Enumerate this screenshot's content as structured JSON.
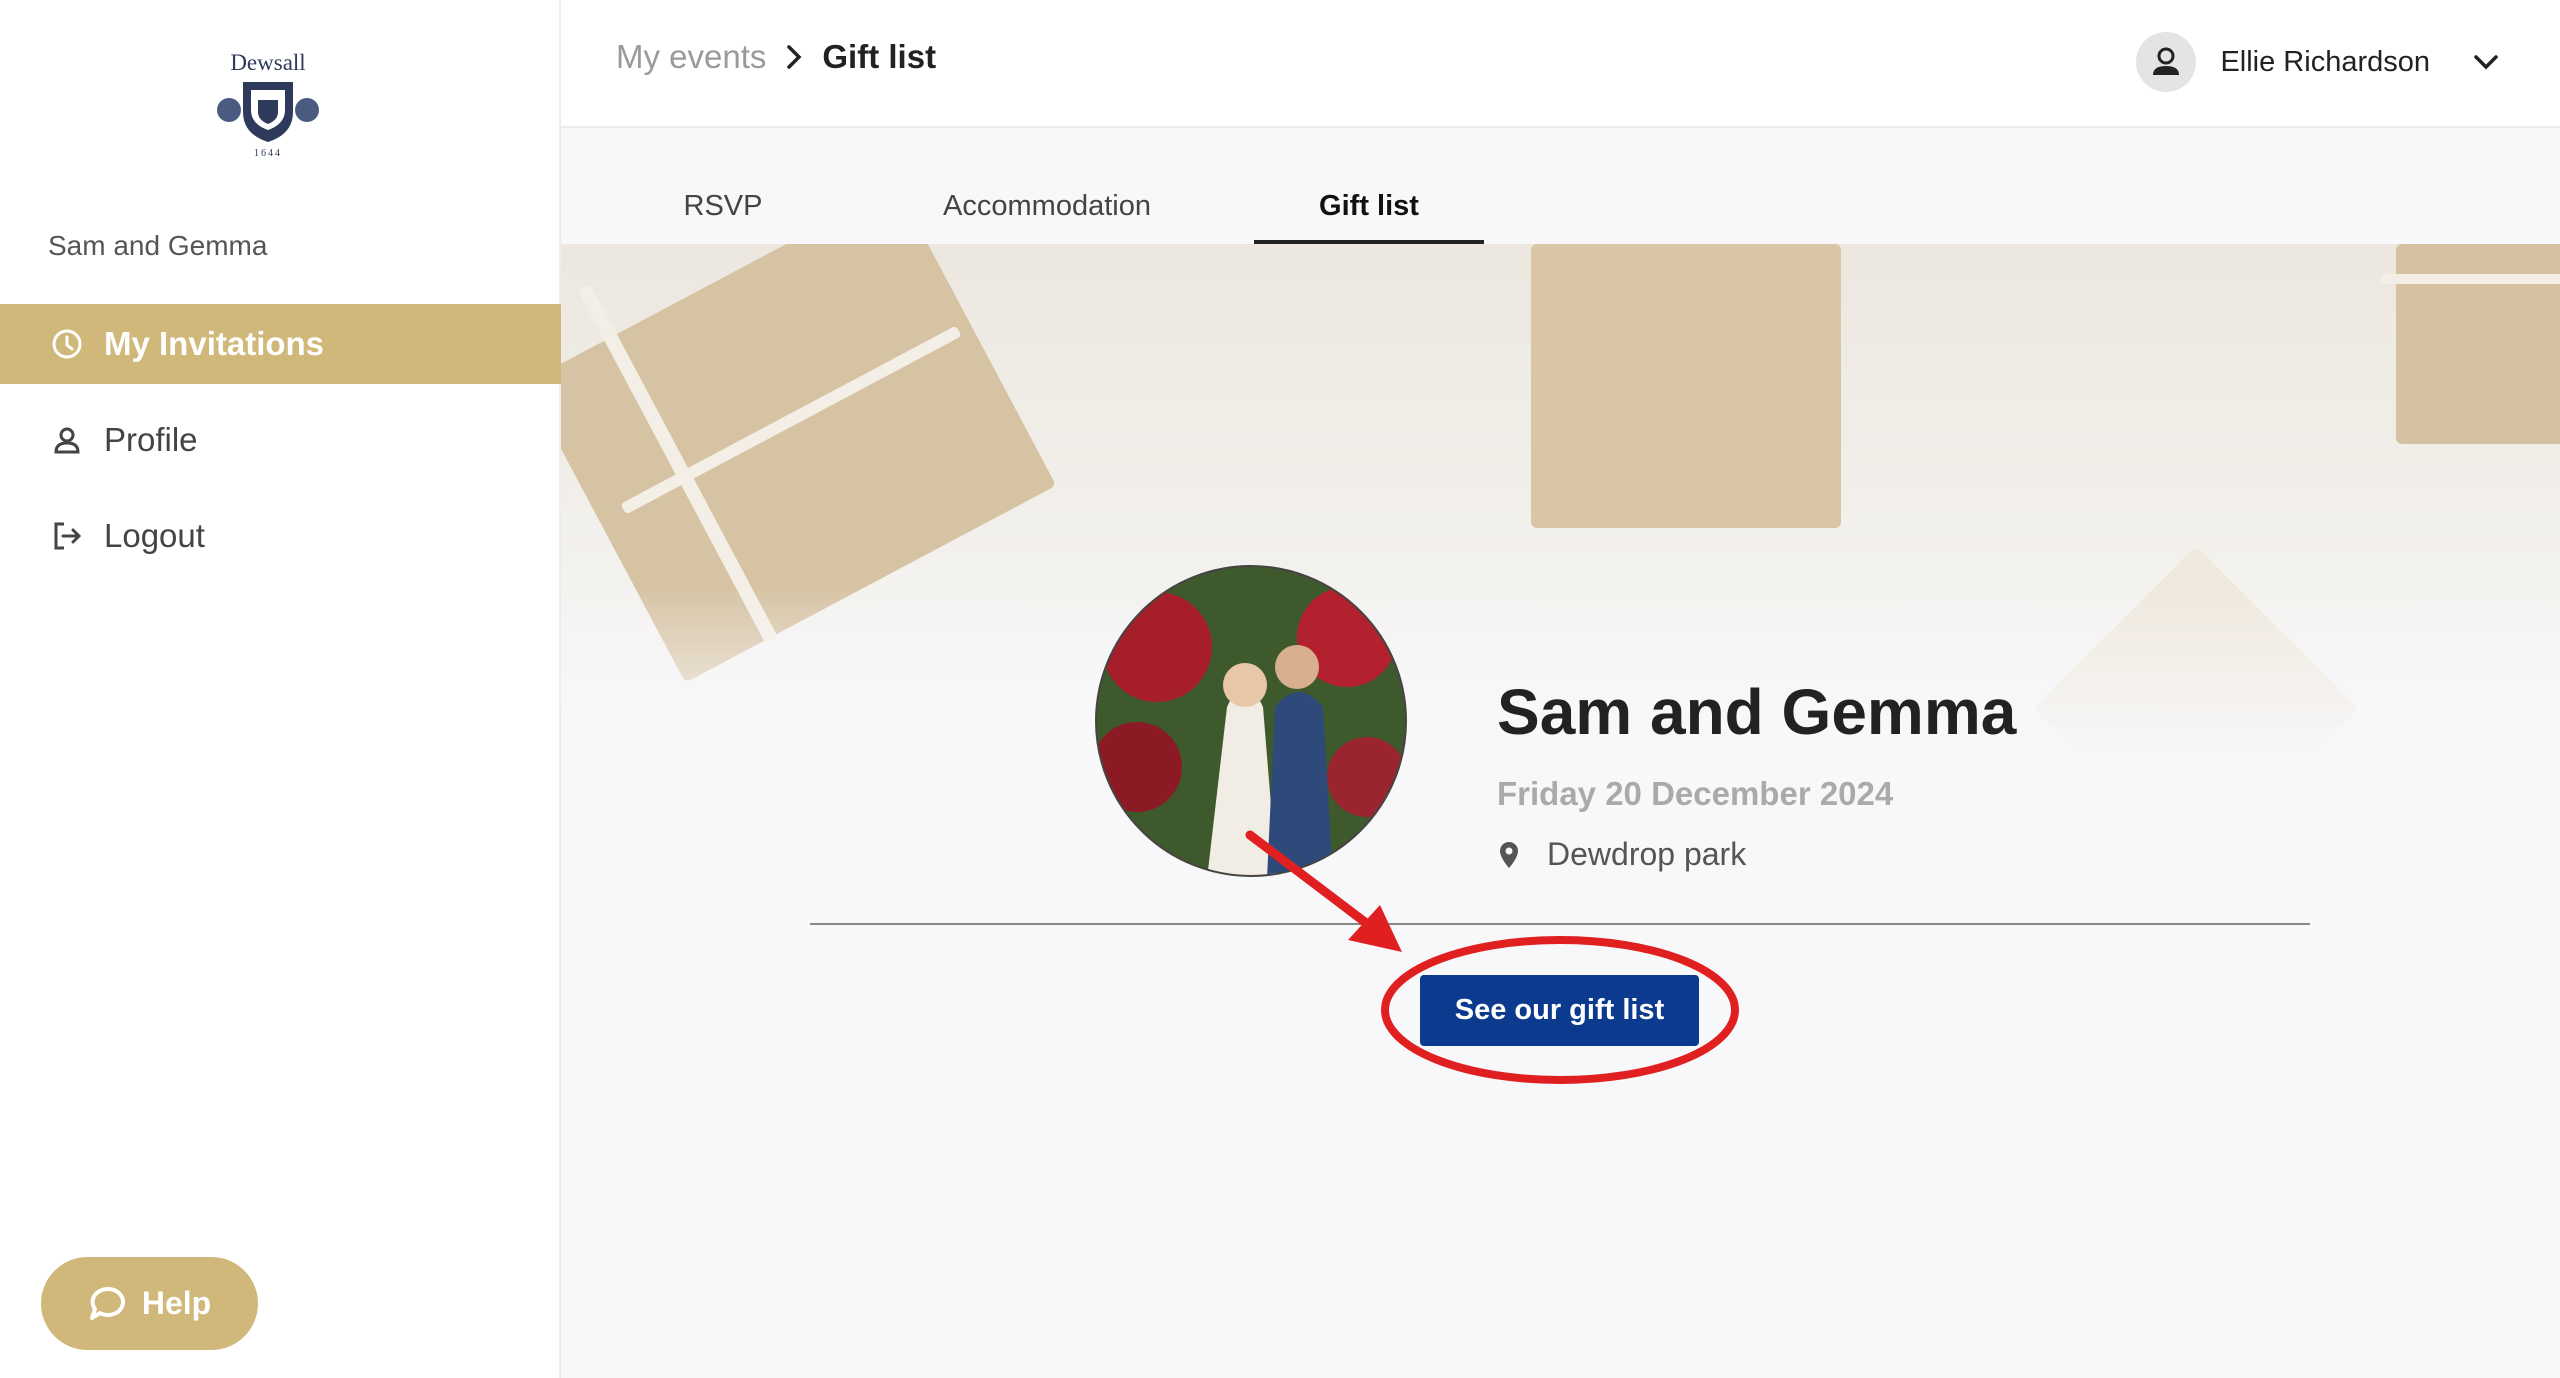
{
  "sidebar": {
    "logo": {
      "text": "Dewsall",
      "year": "1644"
    },
    "org_name": "Sam and Gemma",
    "items": [
      {
        "label": "My Invitations",
        "icon": "clock-icon",
        "active": true
      },
      {
        "label": "Profile",
        "icon": "person-icon",
        "active": false
      },
      {
        "label": "Logout",
        "icon": "logout-icon",
        "active": false
      }
    ],
    "help_label": "Help"
  },
  "header": {
    "breadcrumb": {
      "parent": "My events",
      "current": "Gift list"
    },
    "user_name": "Ellie Richardson"
  },
  "tabs": [
    {
      "label": "RSVP",
      "active": false
    },
    {
      "label": "Accommodation",
      "active": false
    },
    {
      "label": "Gift list",
      "active": true
    }
  ],
  "event": {
    "title": "Sam and Gemma",
    "date": "Friday 20 December 2024",
    "location": "Dewdrop park",
    "cta_label": "See our gift list"
  },
  "colors": {
    "accent_gold": "#cfb87a",
    "cta_blue": "#0b3a8f",
    "annotation_red": "#e02020"
  }
}
